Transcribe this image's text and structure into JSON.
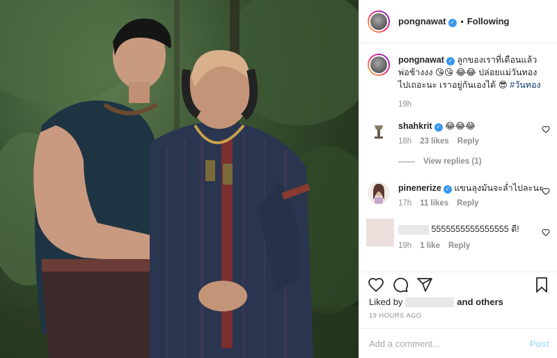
{
  "post": {
    "image_alt": "Two men in traditional Thai costume posing in a forest",
    "image_text": ""
  },
  "header": {
    "username": "pongnawat",
    "verified": "✓",
    "separator": "•",
    "follow_state": "Following"
  },
  "caption": {
    "username": "pongnawat",
    "text": "ลูกของเราที่เดือนแล้ว พ่อช้างงง 😘😘 😂😂 ปล่อยแม่วันทองไปเถอะนะ เราอยู่กันเองได้ 😎",
    "hashtag": "#วันทอง",
    "time": "19h"
  },
  "comments": [
    {
      "username": "shahkrit",
      "text": "😂😂😂",
      "time": "18h",
      "likes": "23 likes",
      "reply": "Reply"
    },
    {
      "username": "pinenerize",
      "text": "แขนลุงมันจะล่ำไปละนะ",
      "time": "17h",
      "likes": "11 likes",
      "reply": "Reply"
    },
    {
      "username": "",
      "text": "5555555555555555 ดี!",
      "time": "19h",
      "likes": "1 like",
      "reply": "Reply"
    }
  ],
  "view_replies": "View replies (1)",
  "liked_by": {
    "prefix": "Liked by",
    "suffix": "and others"
  },
  "timestamp": "19 HOURS AGO",
  "add_comment": {
    "placeholder": "Add a comment...",
    "post_label": "Post"
  },
  "icons": [
    "heart-icon",
    "comment-icon",
    "share-icon",
    "bookmark-icon"
  ],
  "colors": {
    "link": "#003569",
    "verified": "#3897f0",
    "post_disabled": "#b2dffc",
    "meta": "#8e8e8e"
  }
}
